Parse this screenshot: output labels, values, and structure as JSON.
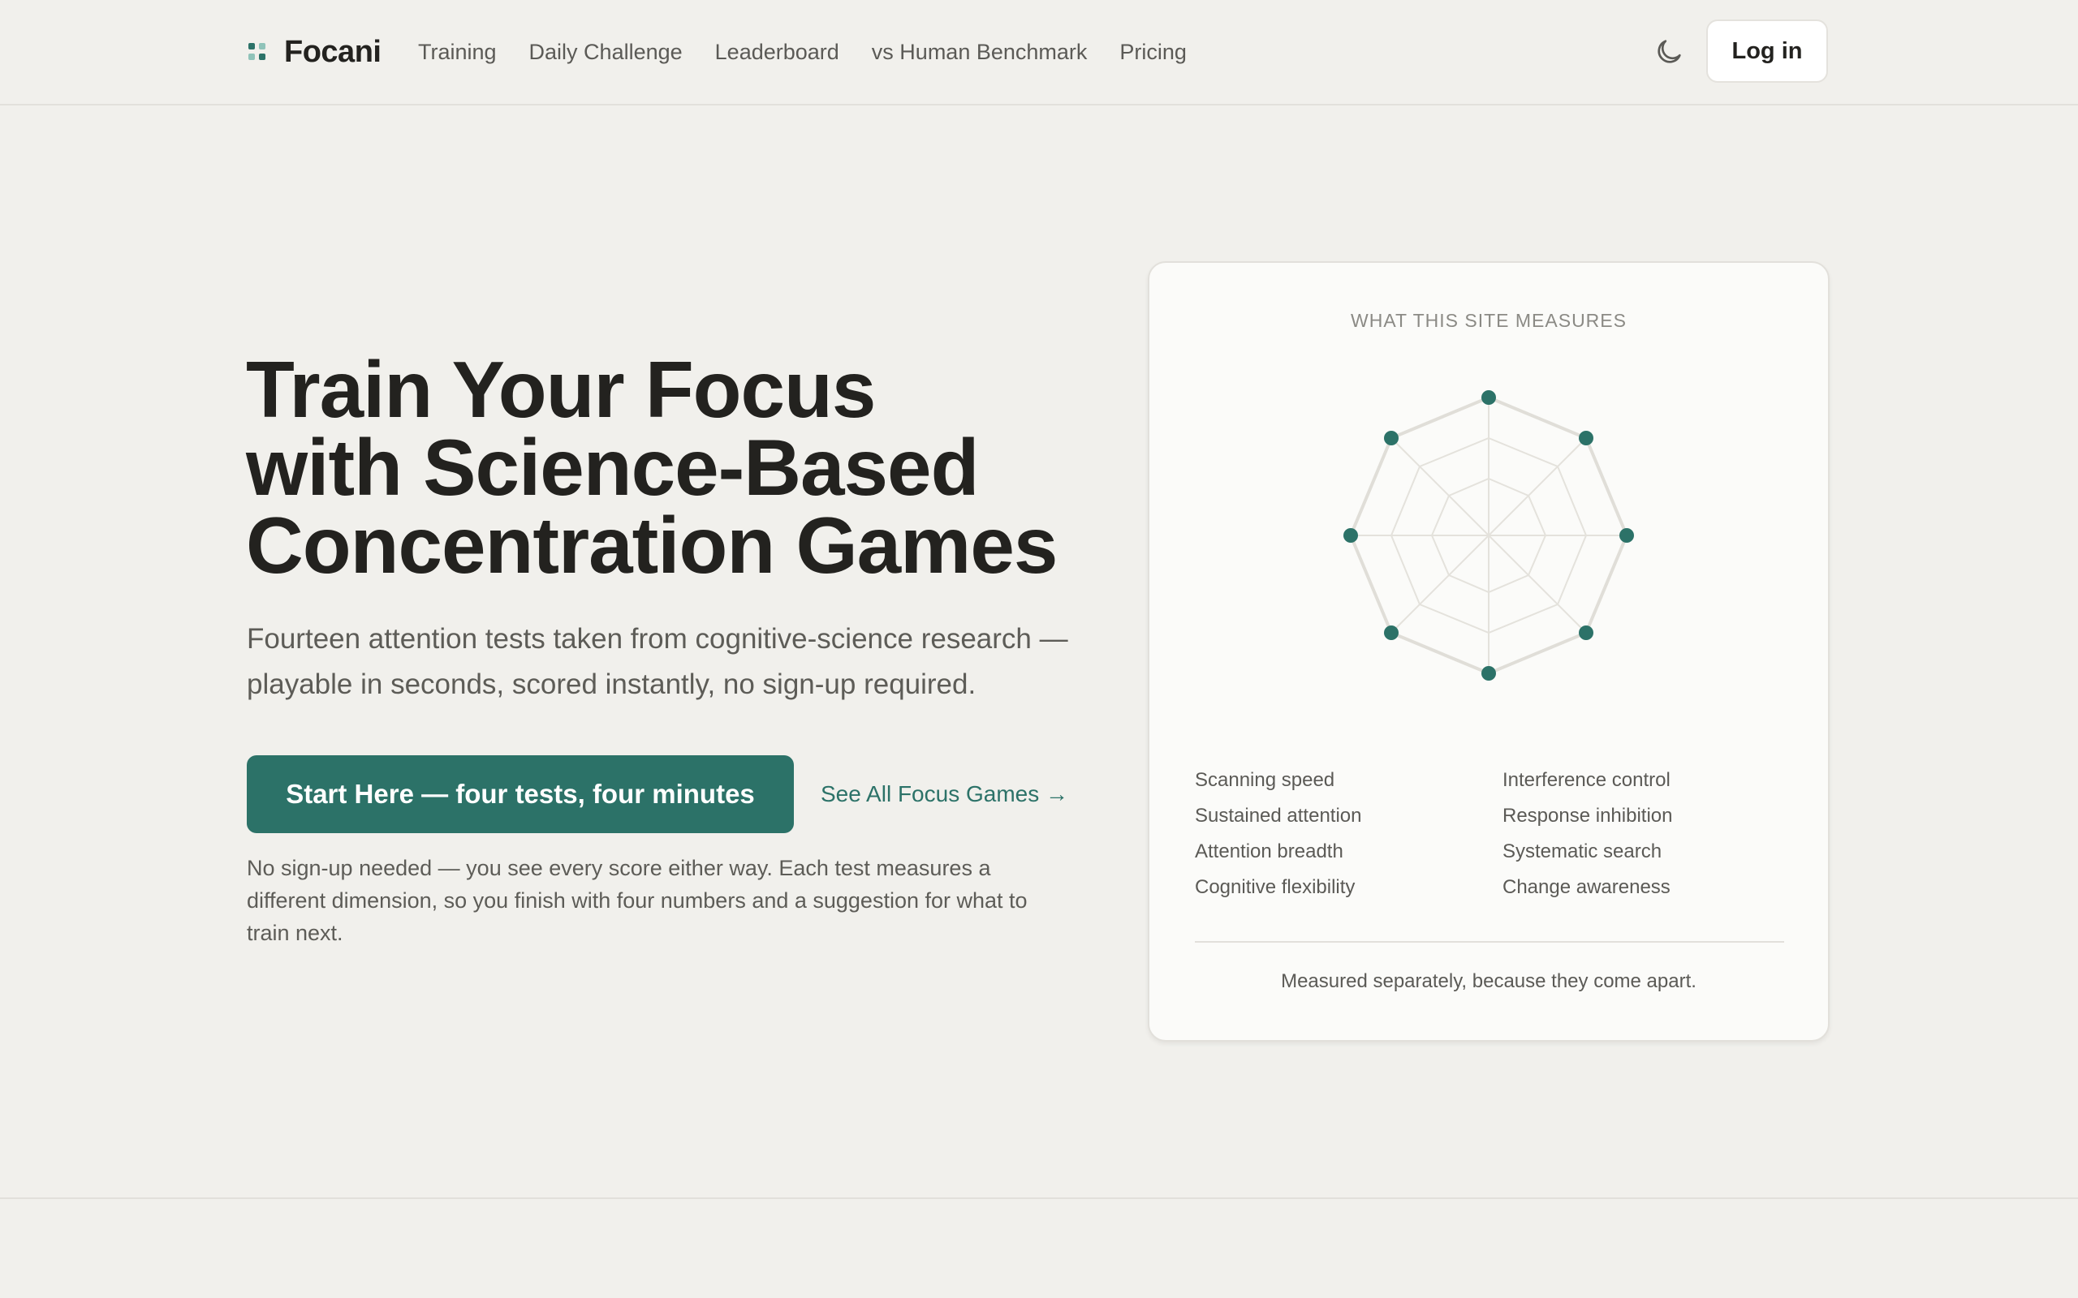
{
  "brand": {
    "name": "Focani",
    "accent": "#2c7268",
    "accent_light": "#8fc3b9"
  },
  "nav": {
    "items": [
      "Training",
      "Daily Challenge",
      "Leaderboard",
      "vs Human Benchmark",
      "Pricing"
    ]
  },
  "header": {
    "theme_icon": "moon-icon",
    "login_label": "Log in"
  },
  "hero": {
    "title_lines": [
      "Train Your Focus",
      "with Science-Based",
      "Concentration Games"
    ],
    "subtitle": "Fourteen attention tests taken from cognitive-science research — playable in seconds, scored instantly, no sign-up required.",
    "primary_cta": "Start Here — four tests, four minutes",
    "secondary_cta": "See All Focus Games →",
    "note": "No sign-up needed — you see every score either way. Each test measures a different dimension, so you finish with four numbers and a suggestion for what to train next."
  },
  "card": {
    "title": "WHAT THIS SITE MEASURES",
    "metrics": [
      "Scanning speed",
      "Interference control",
      "Sustained attention",
      "Response inhibition",
      "Attention breadth",
      "Systematic search",
      "Cognitive flexibility",
      "Change awareness"
    ],
    "footer": "Measured separately, because they come apart."
  }
}
